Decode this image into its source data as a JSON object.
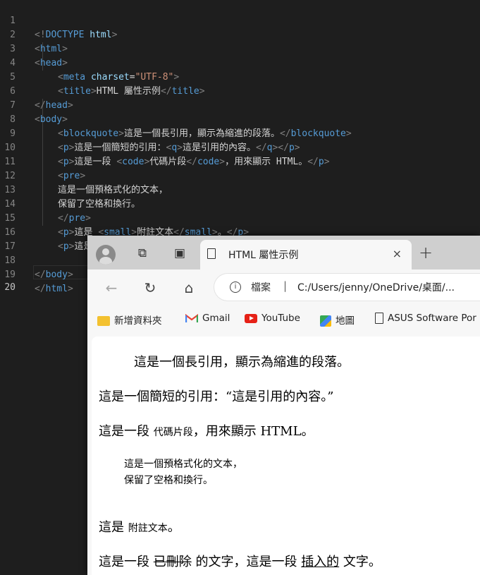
{
  "editor": {
    "lines": [
      {
        "n": "1",
        "code": "<!DOCTYPE html>"
      },
      {
        "n": "2",
        "code": "<html>"
      },
      {
        "n": "3",
        "code": "<head>"
      },
      {
        "n": "4",
        "code": "<meta charset=\"UTF-8\">"
      },
      {
        "n": "5",
        "code": "<title>HTML 屬性示例</title>"
      },
      {
        "n": "6",
        "code": "</head>"
      },
      {
        "n": "7",
        "code": "<body>"
      },
      {
        "n": "8",
        "code": "<blockquote>這是一個長引用，顯示為縮進的段落。</blockquote>"
      },
      {
        "n": "9",
        "code": "<p>這是一個簡短的引用：<q>這是引用的內容。</q></p>"
      },
      {
        "n": "10",
        "code": "<p>這是一段 <code>代碼片段</code>，用來顯示 HTML。</p>"
      },
      {
        "n": "11",
        "code": "<pre>"
      },
      {
        "n": "12",
        "code": "這是一個預格式化的文本，"
      },
      {
        "n": "13",
        "code": "保留了空格和換行。"
      },
      {
        "n": "14",
        "code": "</pre>"
      },
      {
        "n": "15",
        "code": "<p>這是 <small>附註文本</small>。</p>"
      },
      {
        "n": "16",
        "code": "<p>這是一段 <del>已刪除</del> 的文字，這是一段 <ins>插入的</ins> 文字。</p>"
      },
      {
        "n": "17",
        "code": ""
      },
      {
        "n": "18",
        "code": "</body>"
      },
      {
        "n": "19",
        "code": "</html>"
      },
      {
        "n": "20",
        "code": ""
      }
    ]
  },
  "browser": {
    "tab_title": "HTML 屬性示例",
    "tab_close": "×",
    "new_tab": "+",
    "address_label": "檔案",
    "address_sep": "|",
    "address_url": "C:/Users/jenny/OneDrive/桌面/...",
    "bookmarks": [
      {
        "label": "新增資料夾",
        "icon": "folder-icon"
      },
      {
        "label": "Gmail",
        "icon": "gmail-icon"
      },
      {
        "label": "YouTube",
        "icon": "youtube-icon"
      },
      {
        "label": "地圖",
        "icon": "maps-icon"
      },
      {
        "label": "ASUS Software Por",
        "icon": "page-icon"
      }
    ],
    "content": {
      "blockquote": "這是一個長引用，顯示為縮進的段落。",
      "q_prefix": "這是一個簡短的引用：",
      "q_text": "“這是引用的內容。”",
      "code_prefix": "這是一段 ",
      "code_text": "代碼片段",
      "code_suffix": "，用來顯示 HTML。",
      "pre_line1": "這是一個預格式化的文本，",
      "pre_line2": "保留了空格和換行。",
      "small_prefix": "這是 ",
      "small_text": "附註文本",
      "small_suffix": "。",
      "del_prefix": "這是一段 ",
      "del_text": "已刪除",
      "del_mid": " 的文字，這是一段 ",
      "ins_text": "插入的",
      "ins_suffix": " 文字。"
    }
  }
}
